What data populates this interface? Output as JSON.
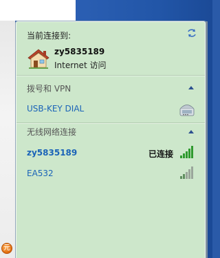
{
  "current": {
    "label": "当前连接到:",
    "network_name": "zy5835189",
    "access_status": "Internet 访问"
  },
  "dialup_vpn": {
    "header": "拨号和 VPN",
    "items": [
      {
        "label": "USB-KEY DIAL",
        "icon": "modem-phone-icon"
      }
    ]
  },
  "wireless": {
    "header": "无线网络连接",
    "items": [
      {
        "label": "zy5835189",
        "status": "已连接",
        "signal_bars": 5,
        "connected": true
      },
      {
        "label": "EA532",
        "status": "",
        "signal_bars": 2,
        "connected": false
      }
    ]
  },
  "colors": {
    "panel_bg": "#cde7cb",
    "link": "#1a63b8",
    "signal_green": "#2f9a2f",
    "signal_gray": "#9aa59a",
    "desktop_blue": "#2256a8"
  },
  "icons": [
    "refresh-icon",
    "home-network-icon",
    "collapse-up-icon",
    "modem-phone-icon",
    "wifi-signal-icon",
    "tray-app-icon"
  ]
}
